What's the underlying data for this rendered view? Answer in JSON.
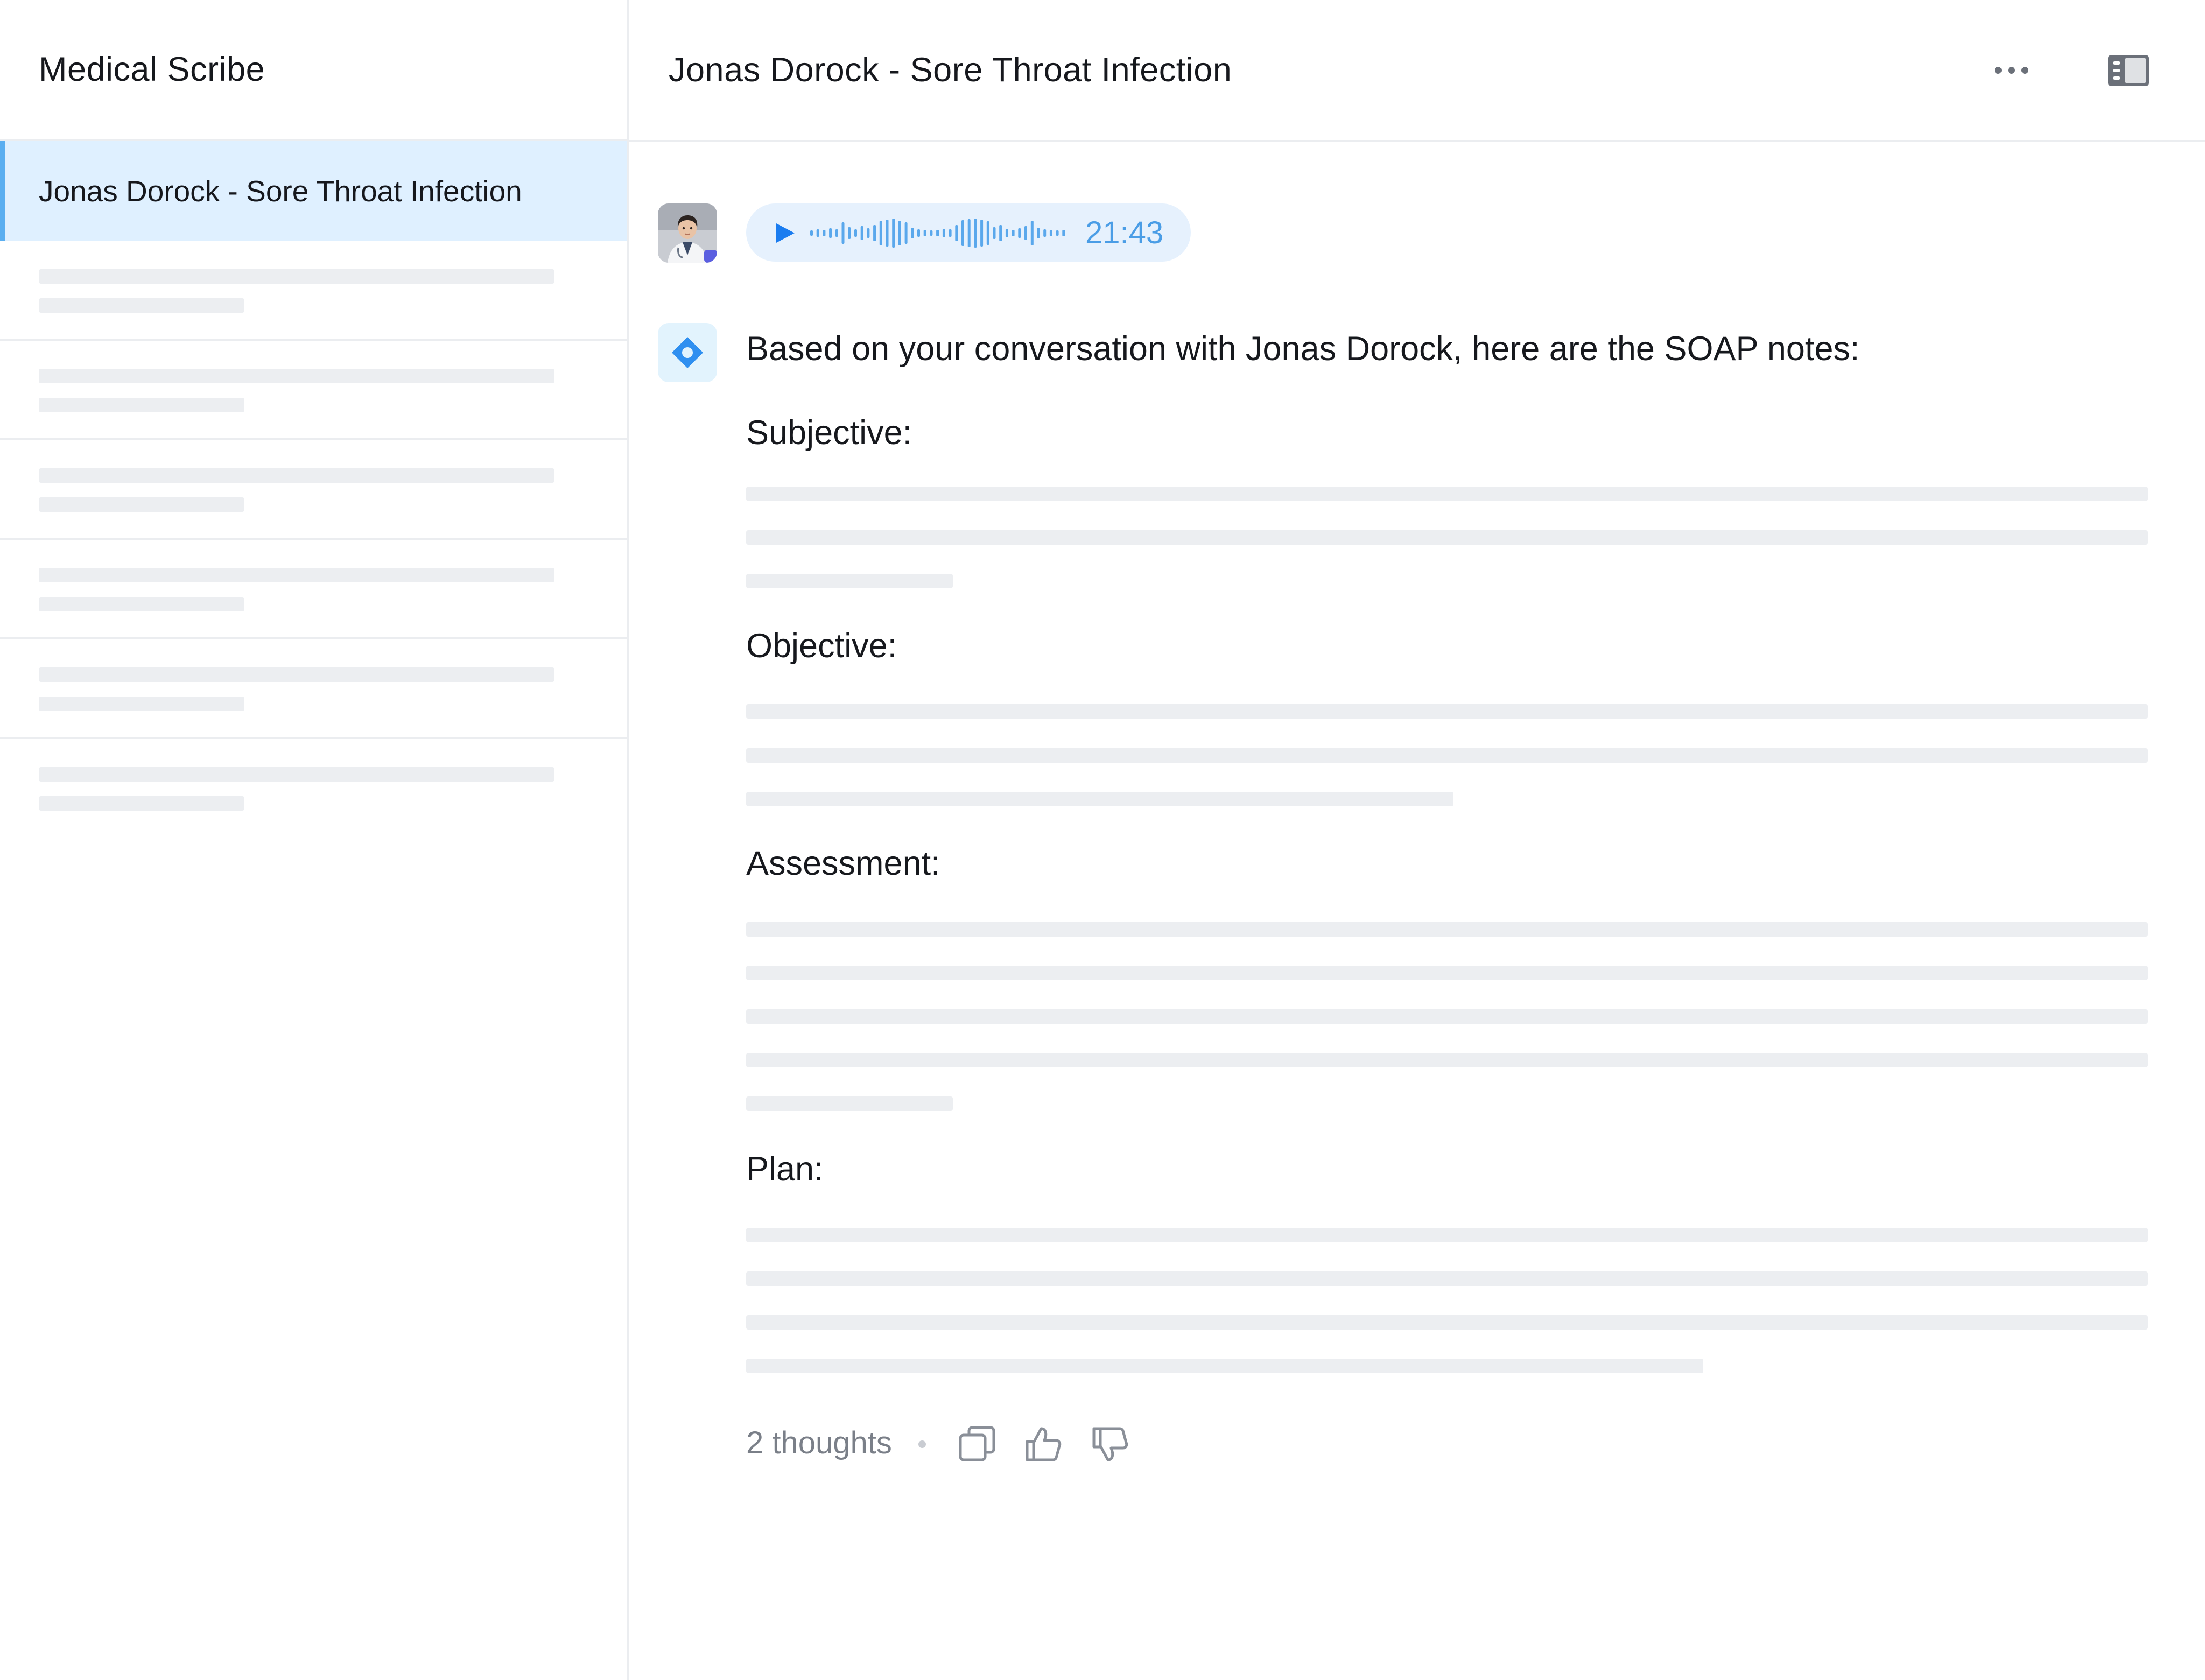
{
  "app": {
    "title": "Medical Scribe"
  },
  "sidebar": {
    "items": [
      {
        "label": "Jonas Dorock - Sore Throat Infection",
        "active": true
      }
    ],
    "placeholder_count": 6
  },
  "header": {
    "title": "Jonas Dorock - Sore Throat Infection",
    "more_icon": "ellipsis-icon",
    "panel_icon": "sidebar-toggle-icon"
  },
  "audio": {
    "duration": "21:43",
    "play_icon": "play-icon",
    "accent_color": "#4a9de6"
  },
  "response": {
    "intro": "Based on your conversation with Jonas Dorock, here are the SOAP notes:",
    "sections": [
      {
        "heading": "Subjective:"
      },
      {
        "heading": "Objective:"
      },
      {
        "heading": "Assessment:"
      },
      {
        "heading": "Plan:"
      }
    ]
  },
  "footer": {
    "thoughts": "2 thoughts",
    "icons": [
      "copy-icon",
      "thumbs-up-icon",
      "thumbs-down-icon"
    ]
  },
  "colors": {
    "active_bg": "#dff0ff",
    "active_bar": "#5aaef0",
    "placeholder": "#eceef1",
    "border": "#ebedf0"
  }
}
